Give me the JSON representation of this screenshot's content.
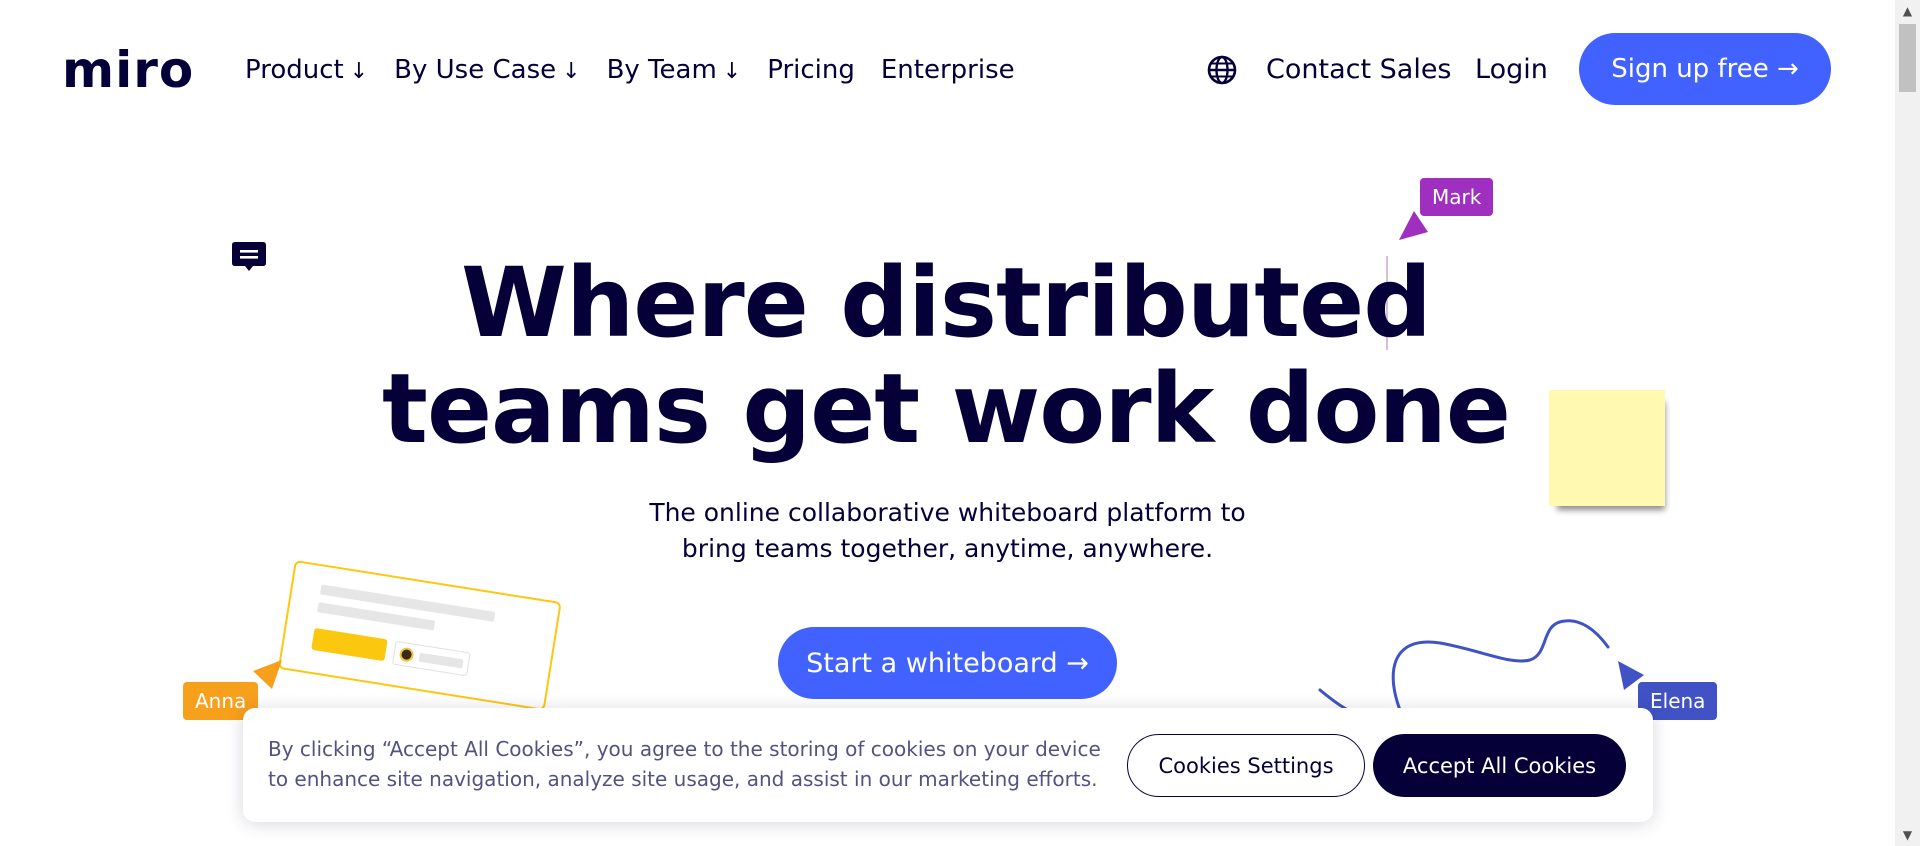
{
  "header": {
    "logo_text": "miro",
    "nav": [
      {
        "label": "Product",
        "arrow": "↓"
      },
      {
        "label": "By Use Case",
        "arrow": "↓"
      },
      {
        "label": "By Team",
        "arrow": "↓"
      },
      {
        "label": "Pricing",
        "arrow": ""
      },
      {
        "label": "Enterprise",
        "arrow": ""
      }
    ],
    "language_icon": "globe-icon",
    "contact_label": "Contact Sales",
    "login_label": "Login",
    "signup_label": "Sign up free →"
  },
  "hero": {
    "title_line1": "Where distributed",
    "title_line2": "teams get work done",
    "subtitle_line1": "The online collaborative whiteboard platform to",
    "subtitle_line2": "bring teams together, anytime, anywhere.",
    "cta_label": "Start a whiteboard →"
  },
  "collaborators": {
    "mark": {
      "name": "Mark",
      "color": "#9e2fbf"
    },
    "anna": {
      "name": "Anna",
      "color": "#f7a01c"
    },
    "elena": {
      "name": "Elena",
      "color": "#4152c5"
    }
  },
  "decor": {
    "comment_icon": "comment-icon",
    "sticky_note_color": "#fff9b2",
    "card_accent": "#fcc70f",
    "scribble_color": "#4152c5"
  },
  "cookie_banner": {
    "text_line1": "By clicking “Accept All Cookies”, you agree to the storing of cookies on your device",
    "text_line2": "to enhance site navigation, analyze site usage, and assist in our marketing efforts.",
    "settings_label": "Cookies Settings",
    "accept_label": "Accept All Cookies"
  },
  "colors": {
    "brand_blue": "#4262ff",
    "ink": "#050038"
  }
}
